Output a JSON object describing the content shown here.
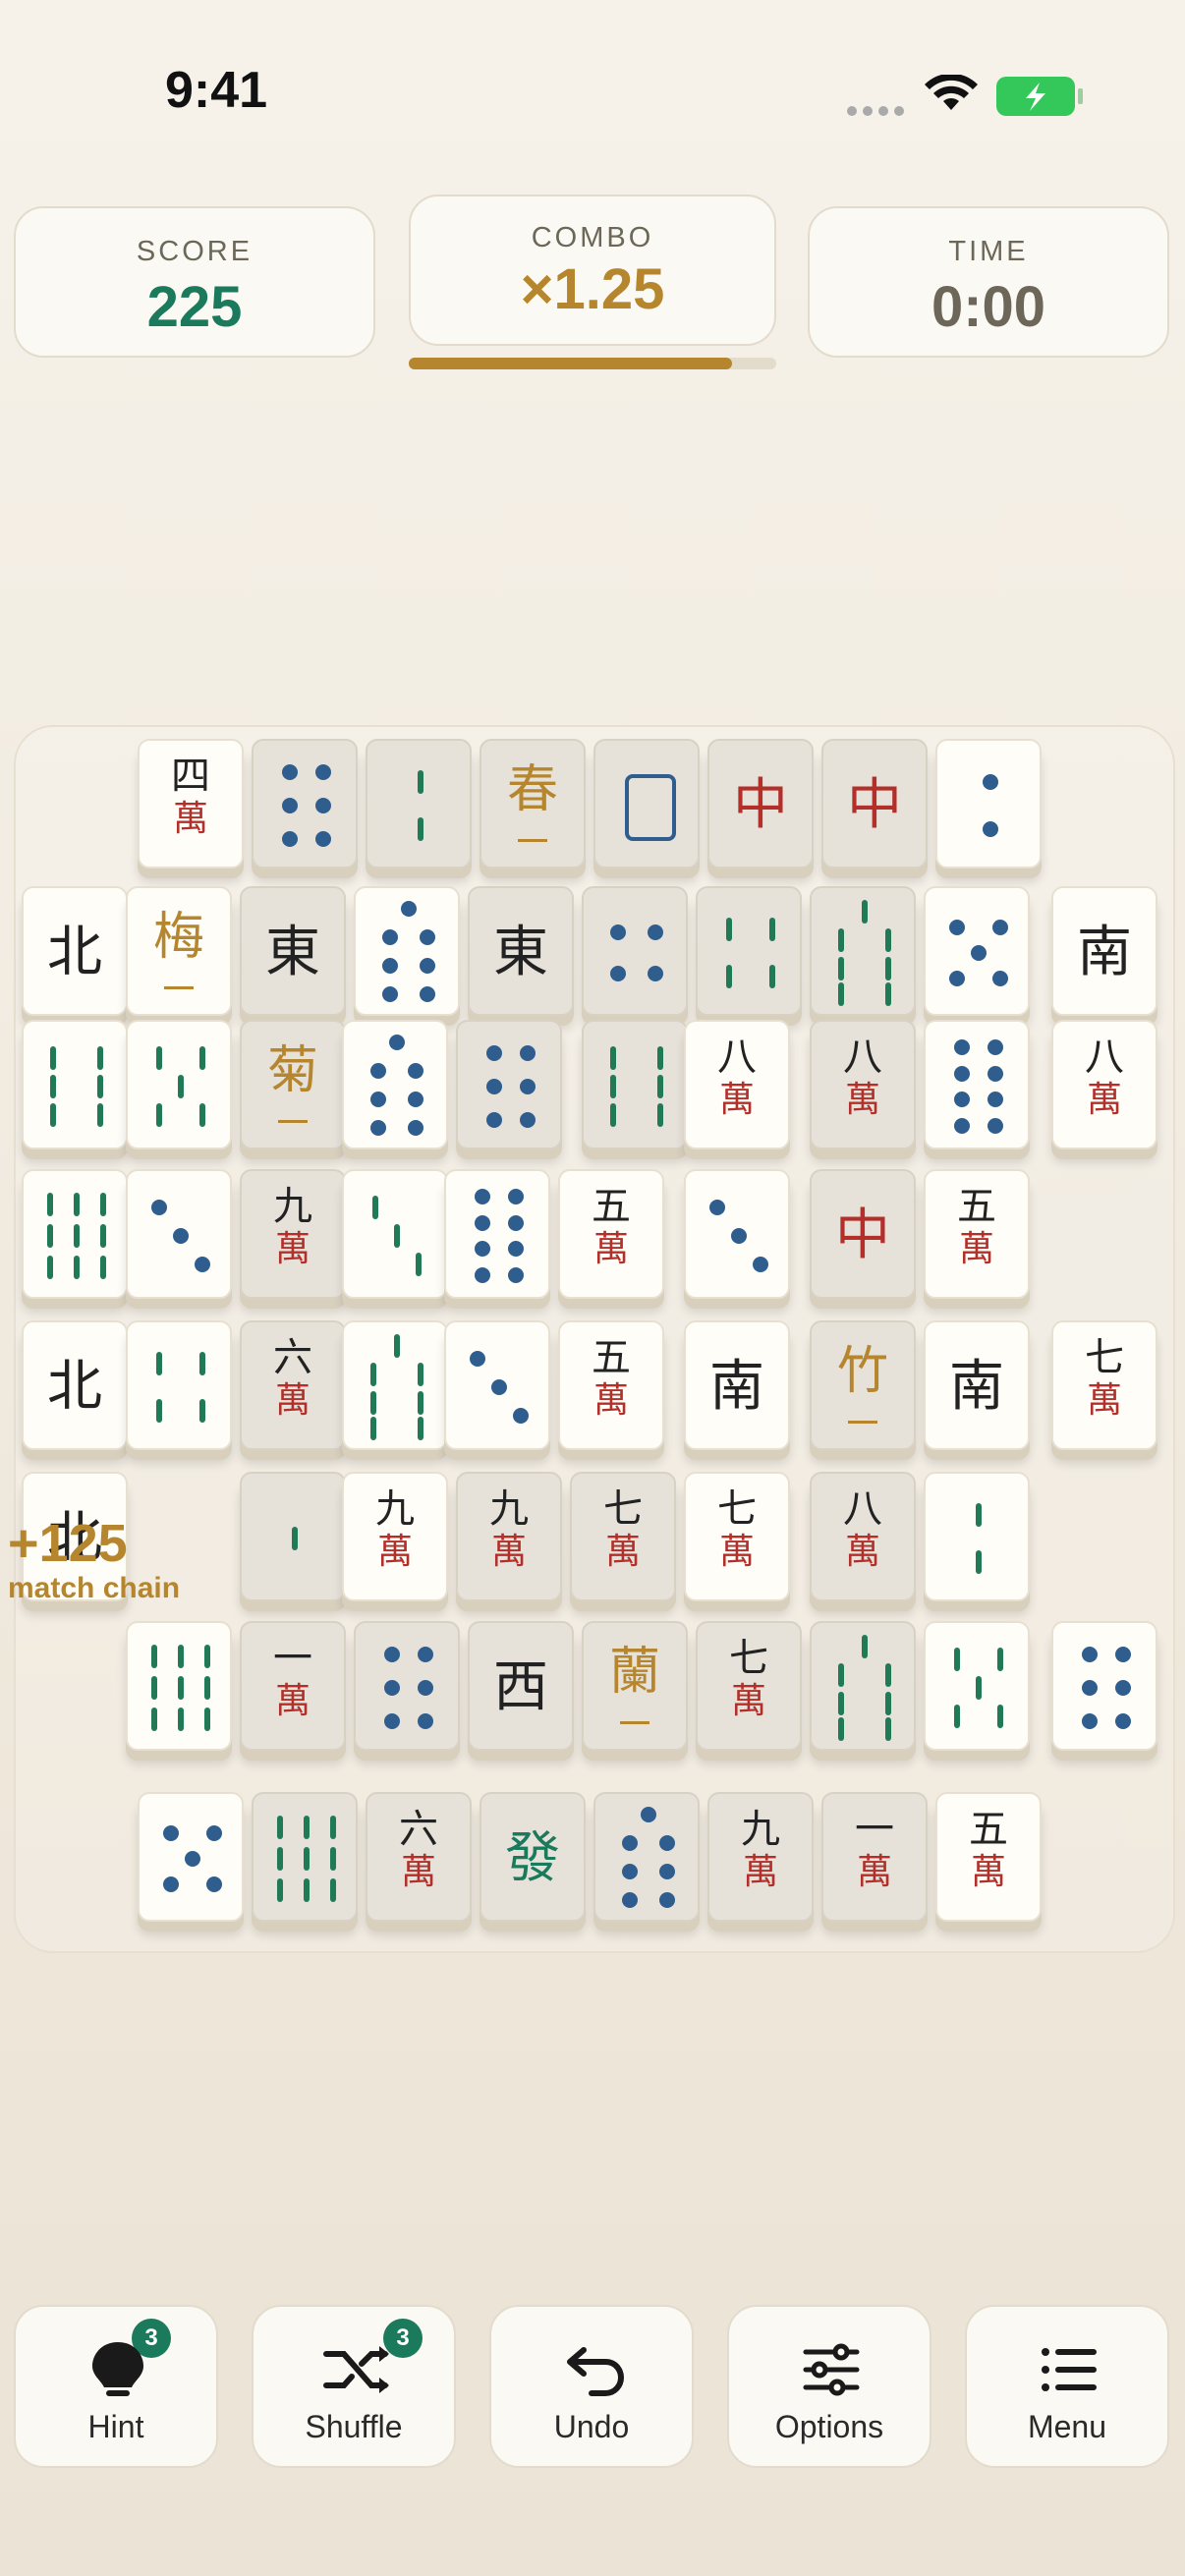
{
  "status": {
    "time": "9:41"
  },
  "stats": {
    "score": {
      "label": "SCORE",
      "value": "225"
    },
    "combo": {
      "label": "COMBO",
      "value": "×1.25",
      "progress": 0.88
    },
    "time": {
      "label": "TIME",
      "value": "0:00"
    }
  },
  "bonus": {
    "points": "+125",
    "text": "match chain"
  },
  "colors": {
    "green": "#1c7a5c",
    "gold": "#b5862e",
    "red": "#b3302a",
    "blue": "#2f5e8e"
  },
  "tiles": {
    "r1": [
      "四萬",
      "●6",
      "|2",
      "春",
      "□",
      "中",
      "中",
      "●2"
    ],
    "r2": [
      "北",
      "梅",
      "東",
      "●7",
      "東",
      "●4",
      "||4",
      "||7",
      "●5",
      "南"
    ],
    "r3": [
      "||6",
      "||5",
      "菊",
      "●7",
      "●6",
      "||6",
      "八萬",
      "八萬",
      "●8",
      "八萬"
    ],
    "r4": [
      "||9",
      "●3",
      "九萬",
      "||3",
      "●8",
      "五萬",
      "●3",
      "中",
      "五萬"
    ],
    "r5": [
      "北",
      "||4",
      "六萬",
      "||7",
      "●3",
      "五萬",
      "南",
      "竹",
      "南",
      "七萬"
    ],
    "r6": [
      "北",
      "|1",
      "九萬",
      "九萬",
      "七萬",
      "七萬",
      "八萬",
      "||2"
    ],
    "r7": [
      "||9",
      "一萬",
      "●6",
      "西",
      "蘭",
      "七萬",
      "||7",
      "||5",
      "●6"
    ],
    "r8": [
      "●5",
      "||9",
      "六萬",
      "發",
      "●7",
      "九萬",
      "一萬",
      "五萬"
    ]
  },
  "buttons": [
    {
      "label": "Hint",
      "icon": "lightbulb-icon",
      "badge": "3"
    },
    {
      "label": "Shuffle",
      "icon": "shuffle-icon",
      "badge": "3"
    },
    {
      "label": "Undo",
      "icon": "undo-icon"
    },
    {
      "label": "Options",
      "icon": "sliders-icon"
    },
    {
      "label": "Menu",
      "icon": "list-icon"
    }
  ]
}
